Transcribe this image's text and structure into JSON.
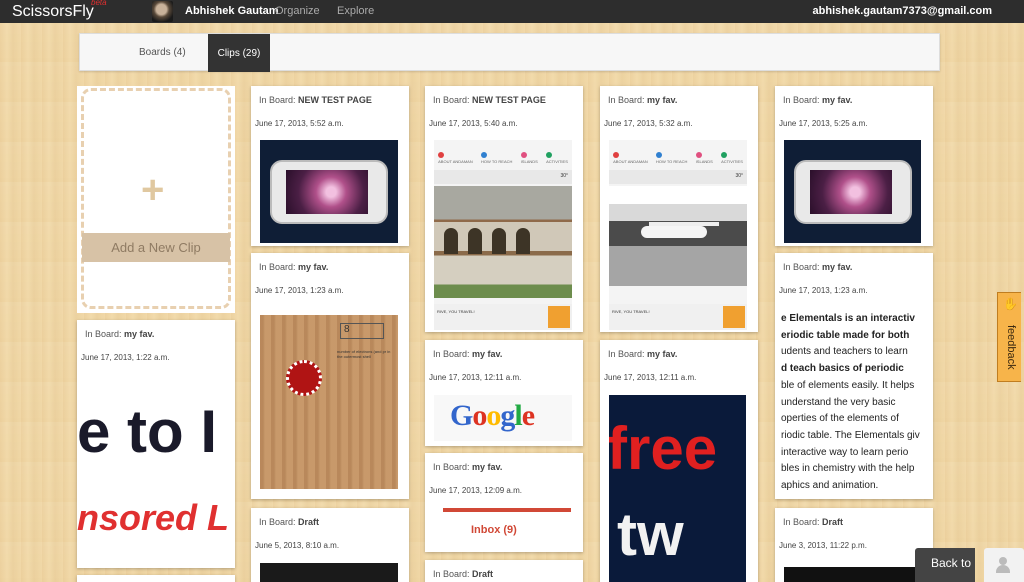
{
  "topbar": {
    "brand": "ScissorsFly",
    "beta": "beta",
    "user_name": "Abhishek Gautam",
    "nav": [
      "Organize",
      "Explore"
    ],
    "email": "abhishek.gautam7373@gmail.com"
  },
  "tabs": {
    "boards": "Boards (4)",
    "clips": "Clips (29)"
  },
  "new_clip": {
    "plus": "+",
    "label": "Add a New Clip"
  },
  "board_prefix": "In Board:",
  "cards": {
    "c1": {
      "board": "my fav.",
      "date": "June 17, 2013, 1:22 a.m.",
      "line1": "e to I",
      "line2": "nsored L"
    },
    "c2": {
      "board": "NEW TEST PAGE",
      "date": "June 17, 2013, 5:52 a.m."
    },
    "c3": {
      "board": "my fav.",
      "date": "June 17, 2013, 1:23 a.m.",
      "box_number": "8",
      "note": "number of electrons (and pr in the outermost shell"
    },
    "c4": {
      "board": "Draft",
      "date": "June 5, 2013, 8:10 a.m."
    },
    "c5": {
      "board": "NEW TEST PAGE",
      "date": "June 17, 2013, 5:40 a.m."
    },
    "c6": {
      "board": "my fav.",
      "date": "June 17, 2013, 12:11 a.m.",
      "google": [
        "G",
        "o",
        "o",
        "g",
        "l",
        "e"
      ]
    },
    "c7": {
      "board": "my fav.",
      "date": "June 17, 2013, 12:09 a.m.",
      "inbox": "Inbox (9)"
    },
    "c8": {
      "board": "Draft"
    },
    "c9": {
      "board": "my fav.",
      "date": "June 17, 2013, 5:32 a.m."
    },
    "c10": {
      "board": "my fav.",
      "date": "June 17, 2013, 12:11 a.m.",
      "line1": "free",
      "line2": "tw"
    },
    "c11": {
      "board": "my fav.",
      "date": "June 17, 2013, 5:25 a.m."
    },
    "c12": {
      "board": "my fav.",
      "date": "June 17, 2013, 1:23 a.m.",
      "lines": [
        "e Elementals is an interactiv",
        "eriodic table made for both",
        "udents and teachers to learn",
        "d teach basics of periodic",
        "ble of elements easily. It helps",
        "understand the very basic",
        "operties of the elements of",
        "riodic table. The Elementals giv",
        "interactive way to learn perio",
        "bles in chemistry with the help",
        "aphics and animation."
      ]
    },
    "c13": {
      "board": "Draft",
      "date": "June 3, 2013, 11:22 p.m."
    }
  },
  "site_thumb": {
    "nav": [
      "ABOUT ANDAMAN",
      "HOW TO REACH",
      "ISLANDS",
      "ACTIVITIES"
    ],
    "temp": "30°",
    "footer": "RIVE, YOU TRAVEL!"
  },
  "feedback": "feedback",
  "back_to_top": "Back to"
}
